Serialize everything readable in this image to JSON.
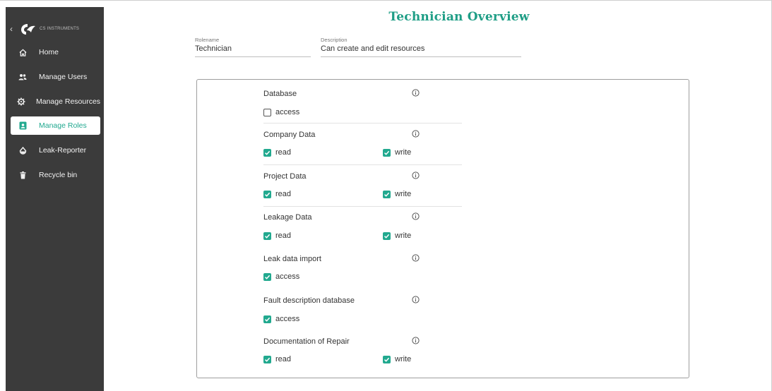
{
  "brand": {
    "logo_text": "CS INSTRUMENTS",
    "accent": "#22a98f",
    "sidebar_bg": "#3b3b3b"
  },
  "sidebar": {
    "collapse_icon": "chevron-left-icon",
    "items": [
      {
        "label": "Home",
        "icon": "home-icon",
        "active": false
      },
      {
        "label": "Manage Users",
        "icon": "users-icon",
        "active": false
      },
      {
        "label": "Manage Resources",
        "icon": "cog-icon",
        "active": false
      },
      {
        "label": "Manage Roles",
        "icon": "badge-icon",
        "active": true
      },
      {
        "label": "Leak-Reporter",
        "icon": "drop-icon",
        "active": false
      },
      {
        "label": "Recycle bin",
        "icon": "trash-icon",
        "active": false
      }
    ]
  },
  "page": {
    "title": "Technician Overview"
  },
  "form": {
    "rolename": {
      "label": "Rolename",
      "value": "Technician"
    },
    "description": {
      "label": "Description",
      "value": "Can create and edit resources"
    }
  },
  "permissions": [
    {
      "title": "Database",
      "options": [
        {
          "label": "access",
          "checked": false
        }
      ]
    },
    {
      "title": "Company Data",
      "options": [
        {
          "label": "read",
          "checked": true
        },
        {
          "label": "write",
          "checked": true
        }
      ]
    },
    {
      "title": "Project Data",
      "options": [
        {
          "label": "read",
          "checked": true
        },
        {
          "label": "write",
          "checked": true
        }
      ]
    },
    {
      "title": "Leakage Data",
      "options": [
        {
          "label": "read",
          "checked": true
        },
        {
          "label": "write",
          "checked": true
        }
      ]
    },
    {
      "title": "Leak data import",
      "options": [
        {
          "label": "access",
          "checked": true
        }
      ]
    },
    {
      "title": "Fault description database",
      "options": [
        {
          "label": "access",
          "checked": true
        }
      ]
    },
    {
      "title": "Documentation of Repair",
      "options": [
        {
          "label": "read",
          "checked": true
        },
        {
          "label": "write",
          "checked": true
        }
      ]
    }
  ]
}
